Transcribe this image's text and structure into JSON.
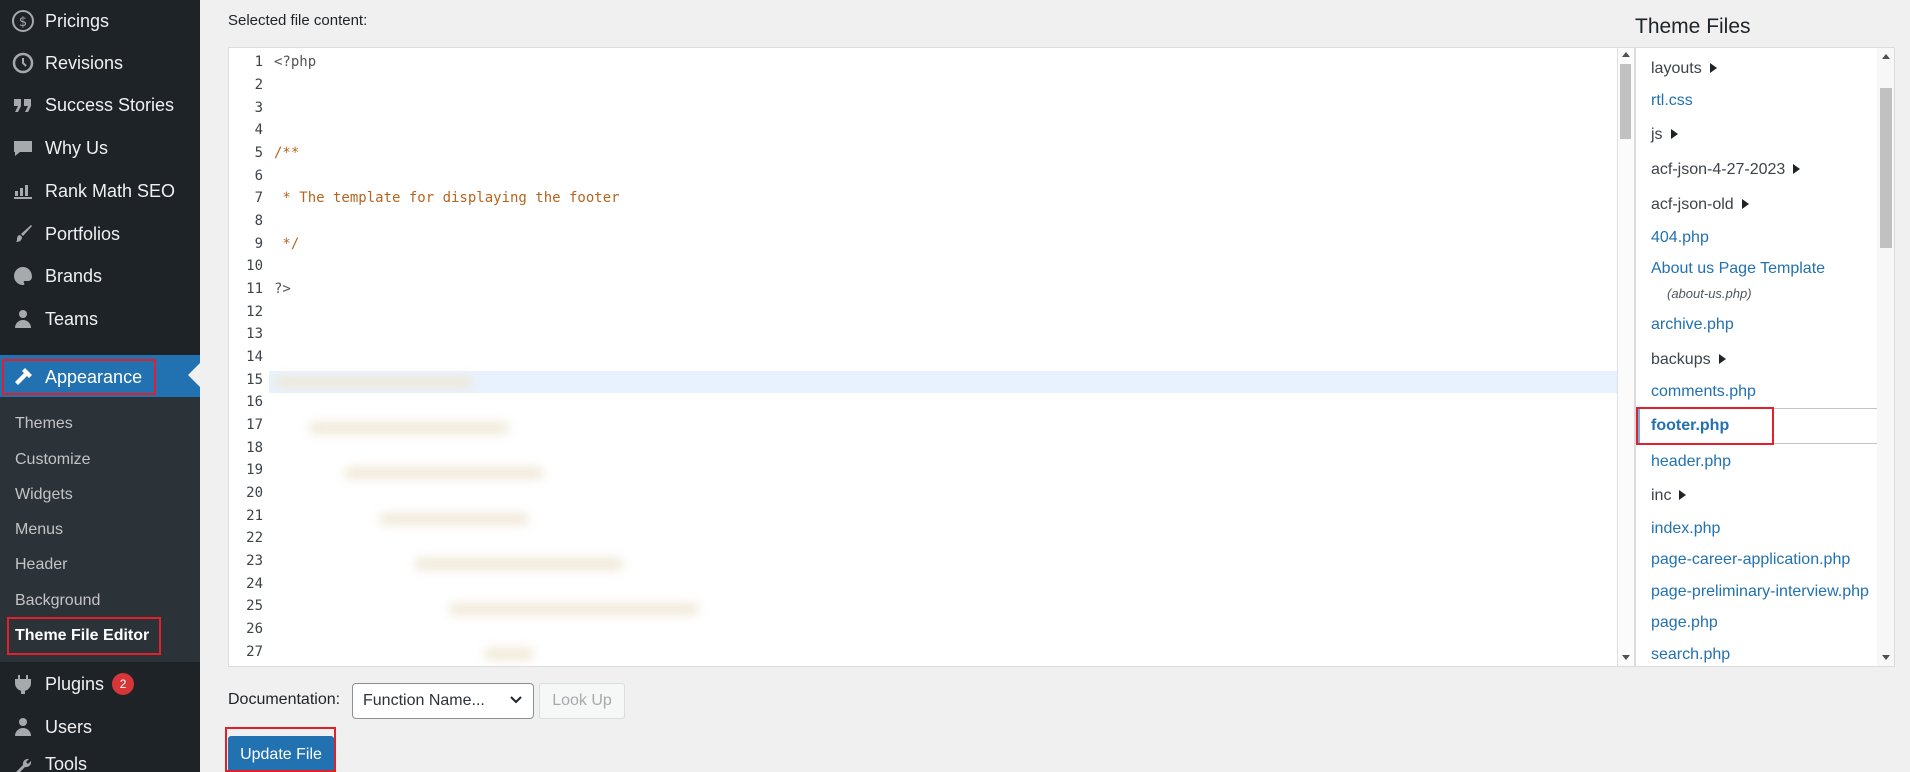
{
  "sidebar": {
    "items": [
      {
        "label": "Pricings",
        "icon": "dollar-icon"
      },
      {
        "label": "Revisions",
        "icon": "history-icon"
      },
      {
        "label": "Success Stories",
        "icon": "quote-icon"
      },
      {
        "label": "Why Us",
        "icon": "speech-bubble-icon"
      },
      {
        "label": "Rank Math SEO",
        "icon": "chart-icon"
      },
      {
        "label": "Portfolios",
        "icon": "brush-icon"
      },
      {
        "label": "Brands",
        "icon": "palette-icon"
      },
      {
        "label": "Teams",
        "icon": "person-icon"
      }
    ],
    "appearance": {
      "label": "Appearance",
      "icon": "hammer-brush-icon"
    },
    "submenu": [
      "Themes",
      "Customize",
      "Widgets",
      "Menus",
      "Header",
      "Background",
      "Theme File Editor"
    ],
    "plugins": {
      "label": "Plugins",
      "badge": "2"
    },
    "users": {
      "label": "Users"
    },
    "tools": {
      "label": "Tools"
    }
  },
  "editor": {
    "label": "Selected file content:",
    "line_numbers": [
      "1",
      "2",
      "3",
      "4",
      "5",
      "6",
      "7",
      "8",
      "9",
      "10",
      "11",
      "12",
      "13",
      "14",
      "15",
      "16",
      "17",
      "18",
      "19",
      "20",
      "21",
      "22",
      "23",
      "24",
      "25",
      "26",
      "27"
    ],
    "lines": {
      "l1": "<?php",
      "l5": "/**",
      "l7": " * The template for displaying the footer",
      "l9": " */",
      "l11": "?>"
    }
  },
  "theme_files": {
    "title": "Theme Files",
    "items": [
      {
        "name": "layouts",
        "folder": true
      },
      {
        "name": "rtl.css"
      },
      {
        "name": "js",
        "folder": true
      },
      {
        "name": "acf-json-4-27-2023",
        "folder": true
      },
      {
        "name": "acf-json-old",
        "folder": true
      },
      {
        "name": "404.php"
      },
      {
        "name": "About us Page Template",
        "sub": "(about-us.php)"
      },
      {
        "name": "archive.php"
      },
      {
        "name": "backups",
        "folder": true
      },
      {
        "name": "comments.php"
      },
      {
        "name": "footer.php",
        "selected": true
      },
      {
        "name": "header.php"
      },
      {
        "name": "inc",
        "folder": true
      },
      {
        "name": "index.php"
      },
      {
        "name": "page-career-application.php"
      },
      {
        "name": "page-preliminary-interview.php"
      },
      {
        "name": "page.php"
      },
      {
        "name": "search.php"
      }
    ]
  },
  "documentation": {
    "label": "Documentation:",
    "select_value": "Function Name...",
    "lookup_label": "Look Up"
  },
  "update_button": "Update File",
  "colors": {
    "sidebar_bg": "#1d2327",
    "accent": "#2271b1",
    "highlight_box": "#e0202a",
    "badge": "#d63638"
  }
}
